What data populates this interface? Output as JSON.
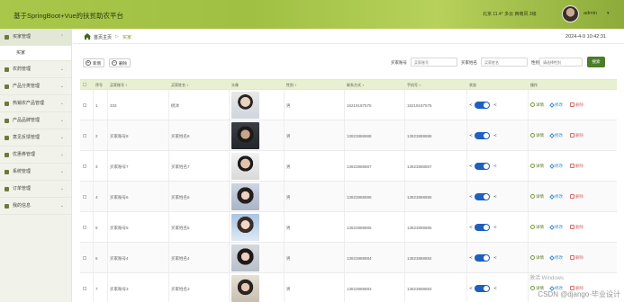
{
  "header": {
    "title": "基于SpringBoot+Vue的扶贫助农平台",
    "weather": "北京  11.4°  多云  西南风  3级",
    "user": "admin"
  },
  "sidebar": {
    "items": [
      {
        "label": "买家管理",
        "active": true,
        "sub": [
          "买家"
        ]
      },
      {
        "label": "农药管理"
      },
      {
        "label": "产品分类管理"
      },
      {
        "label": "热销农产品管理"
      },
      {
        "label": "产品品牌管理"
      },
      {
        "label": "意见反馈管理"
      },
      {
        "label": "优惠券管理"
      },
      {
        "label": "系统管理"
      },
      {
        "label": "订单管理"
      },
      {
        "label": "我的信息"
      }
    ]
  },
  "breadcrumb": {
    "home": "首页主页",
    "sep": "▷",
    "current": "买家",
    "datetime": "2024-4-9  10:42:31"
  },
  "toolbar": {
    "add_label": "新增",
    "delete_label": "删除",
    "filters": [
      {
        "label": "买家账号",
        "placeholder": "买家账号"
      },
      {
        "label": "买家姓名",
        "placeholder": "买家姓名"
      },
      {
        "label": "性别",
        "placeholder": "请选择性别"
      }
    ],
    "search_label": "搜索"
  },
  "table": {
    "headers": [
      "",
      "序号",
      "买家账号 ↕",
      "买家姓名 ↕",
      "头像",
      "性别 ↕",
      "联系方式 ↕",
      "手机号 ↕",
      "状态",
      "操作"
    ],
    "rows": [
      {
        "index": "1",
        "account": "333",
        "name": "桃沐",
        "gender": "男",
        "contact": "15219187575",
        "phone": "15219187575",
        "photo": 0
      },
      {
        "index": "2",
        "account": "买家账号8",
        "name": "买家姓名8",
        "gender": "男",
        "contact": "13823888888",
        "phone": "13823888888",
        "photo": 1
      },
      {
        "index": "3",
        "account": "买家账号7",
        "name": "买家姓名7",
        "gender": "男",
        "contact": "13823888887",
        "phone": "13823888887",
        "photo": 2
      },
      {
        "index": "4",
        "account": "买家账号6",
        "name": "买家姓名6",
        "gender": "男",
        "contact": "13823888886",
        "phone": "13823888886",
        "photo": 3
      },
      {
        "index": "5",
        "account": "买家账号5",
        "name": "买家姓名5",
        "gender": "男",
        "contact": "13823888885",
        "phone": "13823888885",
        "photo": 4
      },
      {
        "index": "6",
        "account": "买家账号4",
        "name": "买家姓名4",
        "gender": "男",
        "contact": "13823888884",
        "phone": "13823888884",
        "photo": 5
      },
      {
        "index": "7",
        "account": "买家账号3",
        "name": "买家姓名3",
        "gender": "男",
        "contact": "13823888883",
        "phone": "13823888883",
        "photo": 6
      }
    ],
    "toggle_left": "≺",
    "toggle_right": "≺",
    "actions": {
      "detail": "详情",
      "edit": "修改",
      "delete": "删除"
    }
  },
  "overlay": {
    "windows_text": "激活 Windows",
    "watermark": "CSDN @django-毕业设计"
  },
  "colors": {
    "accent": "#779a2b",
    "header": "#a9c74a",
    "primary_btn": "#4b7d28",
    "toggle": "#1f5fbf",
    "thead": "#e7f0d0"
  }
}
